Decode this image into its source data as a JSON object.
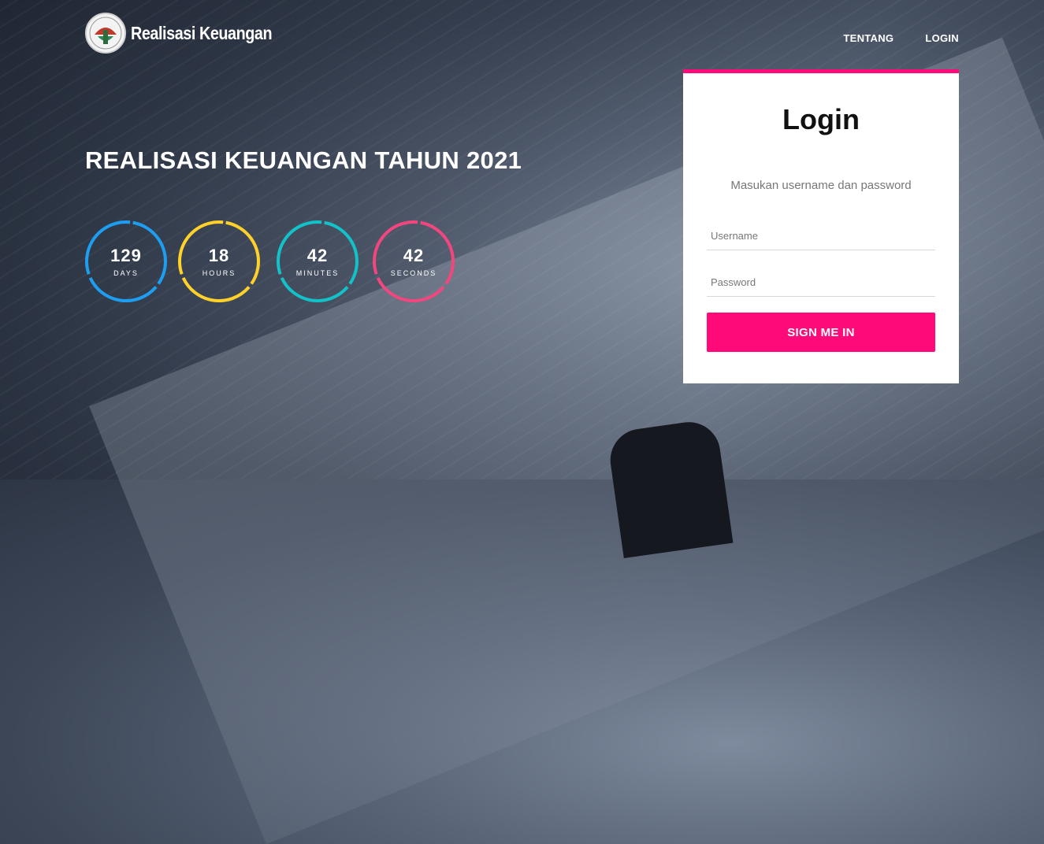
{
  "brand": {
    "name": "Realisasi Keuangan",
    "logo_icon": "ministry-emblem-icon"
  },
  "nav": {
    "items": [
      {
        "label": "TENTANG"
      },
      {
        "label": "LOGIN"
      }
    ]
  },
  "hero": {
    "title": "REALISASI KEUANGAN TAHUN 2021"
  },
  "countdown": [
    {
      "value": "129",
      "label": "DAYS",
      "color": "#1e9ef0"
    },
    {
      "value": "18",
      "label": "HOURS",
      "color": "#ffd12a"
    },
    {
      "value": "42",
      "label": "MINUTES",
      "color": "#13c1c9"
    },
    {
      "value": "42",
      "label": "SECONDS",
      "color": "#f2467f"
    }
  ],
  "login": {
    "title": "Login",
    "subtitle": "Masukan username dan password",
    "username_placeholder": "Username",
    "password_placeholder": "Password",
    "submit_label": "SIGN ME IN",
    "accent_color": "#ff0a78"
  }
}
